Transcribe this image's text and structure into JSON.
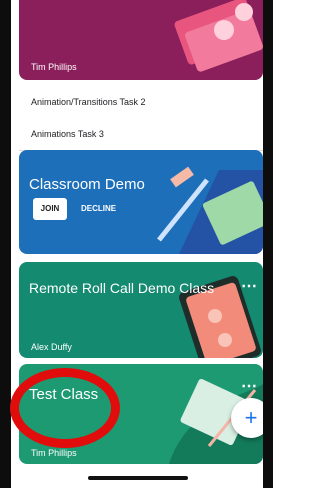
{
  "classes": [
    {
      "owner": "Tim Phillips",
      "color": "#8b1f5b",
      "tasks": [
        "Animation/Transitions Task 2",
        "Animations Task 3"
      ]
    },
    {
      "title": "Classroom Demo",
      "color": "#1d6fb9",
      "join_label": "JOIN",
      "decline_label": "DECLINE"
    },
    {
      "title": "Remote Roll Call Demo Class",
      "owner": "Alex Duffy",
      "color": "#148a70",
      "more_icon": "more-vert-icon"
    },
    {
      "title": "Test Class",
      "owner": "Tim Phillips",
      "color": "#1e9a72",
      "more_icon": "more-vert-icon"
    }
  ],
  "fab_icon": "+",
  "annotation_color": "#e10c0c"
}
